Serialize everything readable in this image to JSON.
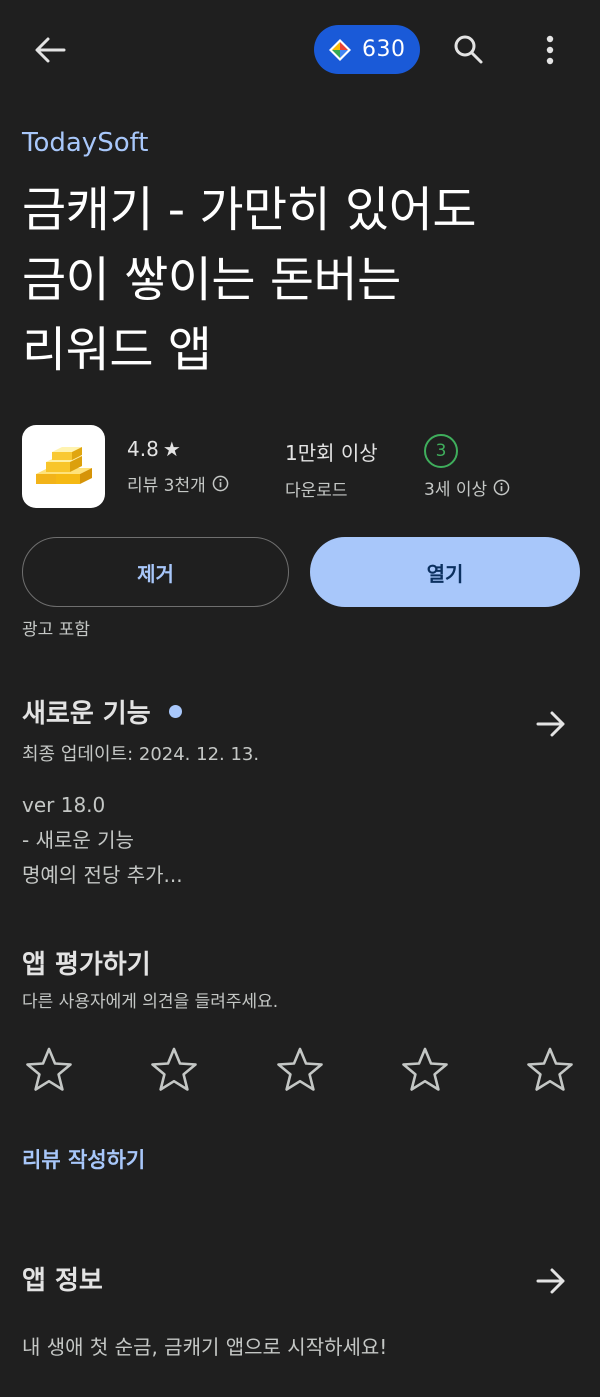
{
  "topbar": {
    "points_value": "630"
  },
  "app": {
    "developer": "TodaySoft",
    "title_lines": [
      "금캐기 - 가만히 있어도",
      "금이 쌓이는 돈버는",
      "리워드 앱"
    ]
  },
  "stats": {
    "rating": "4.8",
    "rating_star": "★",
    "reviews_label": "리뷰 3천개",
    "downloads_value": "1만회 이상",
    "downloads_label": "다운로드",
    "age_badge": "3",
    "age_label": "3세 이상"
  },
  "actions": {
    "remove_label": "제거",
    "open_label": "열기",
    "ads_notice": "광고 포함"
  },
  "whats_new": {
    "title": "새로운 기능",
    "last_updated": "최종 업데이트: 2024. 12. 13.",
    "notes": [
      "ver 18.0",
      "- 새로운 기능",
      "명예의 전당 추가..."
    ]
  },
  "rate": {
    "title": "앱 평가하기",
    "subtitle": "다른 사용자에게 의견을 들려주세요.",
    "rating_value": 0,
    "max_stars": 5,
    "write_review": "리뷰 작성하기"
  },
  "about": {
    "title": "앱 정보",
    "description": "내 생애 첫 순금, 금캐기 앱으로 시작하세요!"
  },
  "colors": {
    "background": "#1f1f1f",
    "accent": "#a8c7fa",
    "points_pill": "#1a5ad8",
    "age_green": "#3fae5c"
  }
}
